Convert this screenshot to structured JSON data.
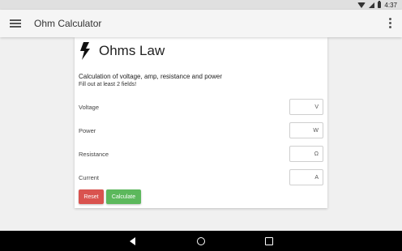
{
  "status_bar": {
    "time": "4:37",
    "icons": [
      "wifi-icon",
      "signal-icon",
      "battery-icon"
    ]
  },
  "app_bar": {
    "title": "Ohm Calculator",
    "menu_icon": "hamburger-icon",
    "overflow_icon": "more-vert-icon"
  },
  "card": {
    "icon": "lightning-bolt-icon",
    "title": "Ohms Law",
    "description": "Calculation of voltage, amp, resistance and power",
    "hint": "Fill out at least 2 fields!",
    "fields": [
      {
        "label": "Voltage",
        "unit": "V"
      },
      {
        "label": "Power",
        "unit": "W"
      },
      {
        "label": "Resistance",
        "unit": "Ω"
      },
      {
        "label": "Current",
        "unit": "A"
      }
    ],
    "reset_label": "Reset",
    "calculate_label": "Calculate"
  },
  "colors": {
    "reset": "#d9534f",
    "calculate": "#5cb85c",
    "app_bar": "#f5f5f5",
    "nav_bar": "#000000"
  }
}
